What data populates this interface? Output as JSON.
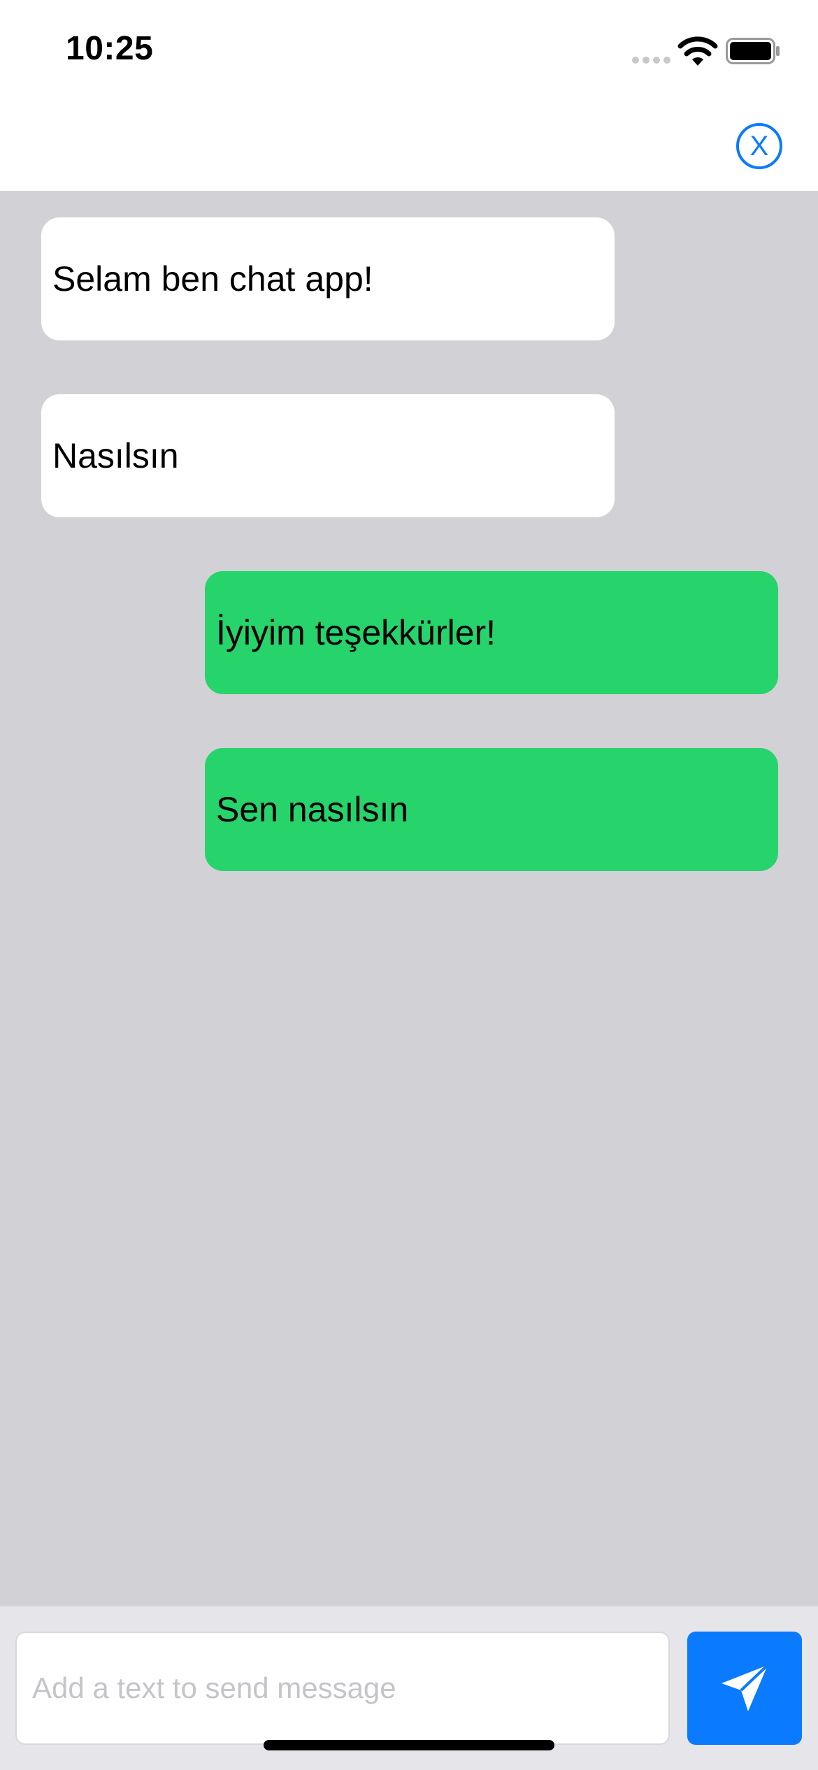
{
  "status_bar": {
    "time": "10:25"
  },
  "nav": {
    "close_label": "X"
  },
  "messages": [
    {
      "text": "Selam ben chat app!",
      "direction": "incoming"
    },
    {
      "text": "Nasılsın",
      "direction": "incoming"
    },
    {
      "text": "İyiyim teşekkürler!",
      "direction": "outgoing"
    },
    {
      "text": "Sen nasılsın",
      "direction": "outgoing"
    }
  ],
  "composer": {
    "placeholder": "Add a text to send message",
    "value": ""
  },
  "colors": {
    "accent": "#0a7aff",
    "outgoing_bubble": "#27d36b",
    "incoming_bubble": "#ffffff",
    "chat_background": "#d1d1d6",
    "input_bar_background": "#e5e5ea"
  },
  "icons": {
    "signal": "cellular-signal-icon",
    "wifi": "wifi-icon",
    "battery": "battery-icon",
    "send": "paper-plane-icon"
  }
}
